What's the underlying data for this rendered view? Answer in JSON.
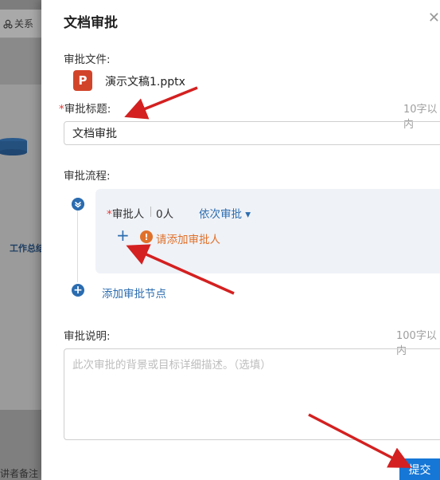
{
  "background": {
    "tab_label": "关系",
    "panel_label": "工作总结",
    "notes_label": "讲者备注"
  },
  "dialog": {
    "title": "文档审批",
    "close_icon": "close-icon",
    "file_section": {
      "label": "审批文件:",
      "file_icon_letter": "P",
      "file_name": "演示文稿1.pptx"
    },
    "title_section": {
      "required_mark": "*",
      "label": "审批标题:",
      "hint": "10字以内",
      "value": "文档审批"
    },
    "flow_section": {
      "label": "审批流程:",
      "approver": {
        "required_mark": "*",
        "label": "审批人",
        "count": "0人",
        "mode": "依次审批 ▾"
      },
      "add_plus": "+",
      "warning_icon": "!",
      "warning_text": "请添加审批人",
      "add_node_text": "添加审批节点"
    },
    "description_section": {
      "label": "审批说明:",
      "hint": "100字以内",
      "placeholder": "此次审批的背景或目标详细描述。（选填）"
    },
    "submit_label": "提交"
  },
  "colors": {
    "accent": "#2b6cb0",
    "primary_button": "#1677d6",
    "warning": "#e0712b",
    "required": "#e53935",
    "annotation_arrow": "#d42020"
  }
}
